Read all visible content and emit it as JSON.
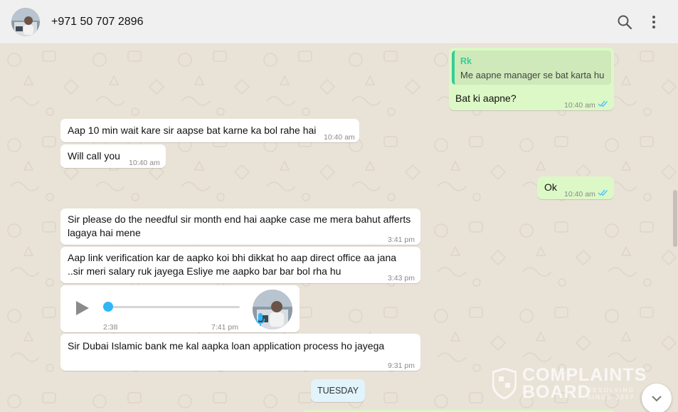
{
  "header": {
    "contact_name": "+971 50 707 2896",
    "icons": [
      "search-icon",
      "more-vertical-icon"
    ]
  },
  "messages": [
    {
      "direction": "out",
      "quote_author": "Rk",
      "quote_text": "Me aapne manager se bat karta hu",
      "text": "Bat ki aapne?",
      "time": "10:40 am",
      "status": "read"
    },
    {
      "direction": "in",
      "text": "Aap 10 min wait kare sir aapse bat karne ka bol rahe hai",
      "time": "10:40 am"
    },
    {
      "direction": "in",
      "text": "Will call you",
      "time": "10:40 am"
    },
    {
      "direction": "out",
      "text": "Ok",
      "time": "10:40 am",
      "status": "read"
    },
    {
      "direction": "in",
      "line1": "Sir please do the needful sir month end hai aapke case me mera bahut afferts",
      "line2": "lagaya hai mene",
      "time": "3:41 pm"
    },
    {
      "direction": "in",
      "line1": "Aap link verification kar de aapko koi bhi dikkat ho aap direct office aa jana",
      "line2": "..sir meri salary ruk jayega Esliye me aapko bar bar bol rha hu",
      "time": "3:43 pm"
    },
    {
      "direction": "in",
      "type": "voice",
      "duration": "2:38",
      "time": "7:41 pm",
      "progress": 0
    },
    {
      "direction": "in",
      "text": "Sir Dubai Islamic bank me kal aapka loan application process ho jayega",
      "time": "9:31 pm"
    }
  ],
  "day_divider": "TUESDAY",
  "watermark": {
    "line1": "COMPLAINTS",
    "line2": "BOARD",
    "tagline": "RESOLVING SINCE 2007"
  },
  "colors": {
    "incoming": "#ffffff",
    "outgoing": "#dcf8c6",
    "read_ticks": "#4fc3f7",
    "quote_accent": "#35cd96",
    "header": "#f0f0f0",
    "day_pill": "#e1f3fb"
  }
}
